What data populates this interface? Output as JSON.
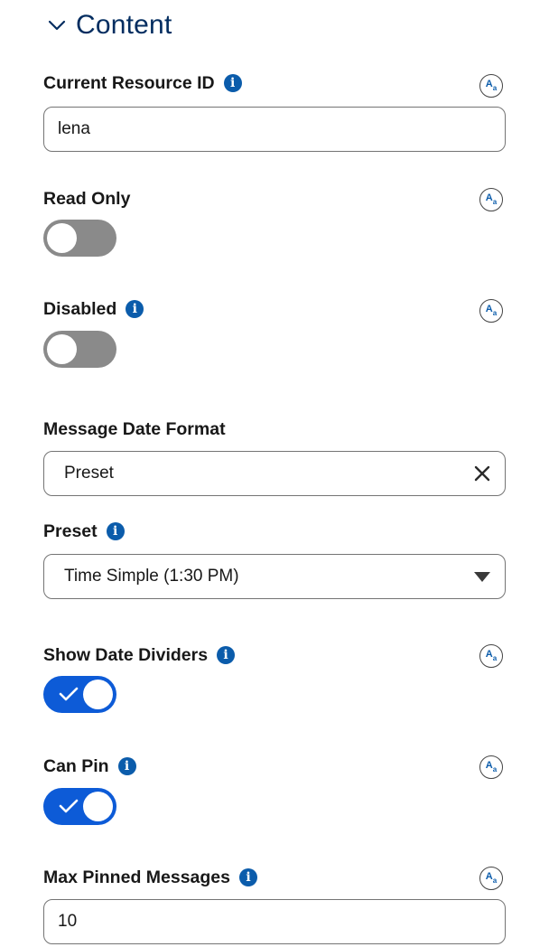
{
  "section": {
    "title": "Content",
    "icon": "chevron-down-icon"
  },
  "fields": {
    "resource_id": {
      "label": "Current Resource ID",
      "value": "lena"
    },
    "read_only": {
      "label": "Read Only",
      "checked": false
    },
    "disabled": {
      "label": "Disabled",
      "checked": false
    },
    "message_date_format": {
      "label": "Message Date Format",
      "value": "Preset"
    },
    "preset": {
      "label": "Preset",
      "value": "Time Simple (1:30 PM)"
    },
    "show_date_dividers": {
      "label": "Show Date Dividers",
      "checked": true
    },
    "can_pin": {
      "label": "Can Pin",
      "checked": true
    },
    "max_pinned_messages": {
      "label": "Max Pinned Messages",
      "value": "10"
    }
  },
  "aa_icon": {
    "big": "A",
    "small": "a"
  },
  "colors": {
    "accent": "#0d5bd7",
    "title": "#032d60",
    "toggle_off": "#8a8a8a",
    "info": "#0b5cab"
  }
}
